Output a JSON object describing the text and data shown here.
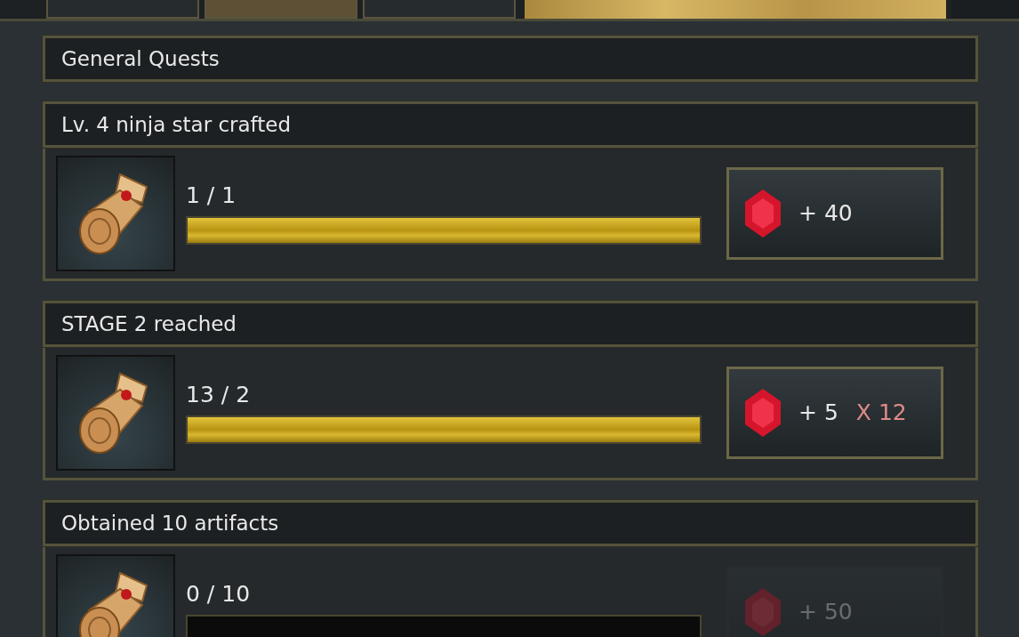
{
  "top_tabs": [
    {
      "selected": false
    },
    {
      "selected": true
    },
    {
      "selected": false
    }
  ],
  "section": {
    "title": "General Quests"
  },
  "quests": [
    {
      "title": "Lv. 4 ninja star crafted",
      "progress": "1 / 1",
      "level": 1,
      "reward": "+ 40",
      "claimable": true
    },
    {
      "title": "STAGE 2 reached",
      "progress": "13 / 2",
      "level": 1,
      "reward": "+ 5",
      "multiplier": "X 12",
      "claimable": true
    },
    {
      "title": "Obtained 10 artifacts",
      "progress": "0 / 10",
      "level": 0,
      "reward": "+ 50",
      "claimable": false
    }
  ]
}
